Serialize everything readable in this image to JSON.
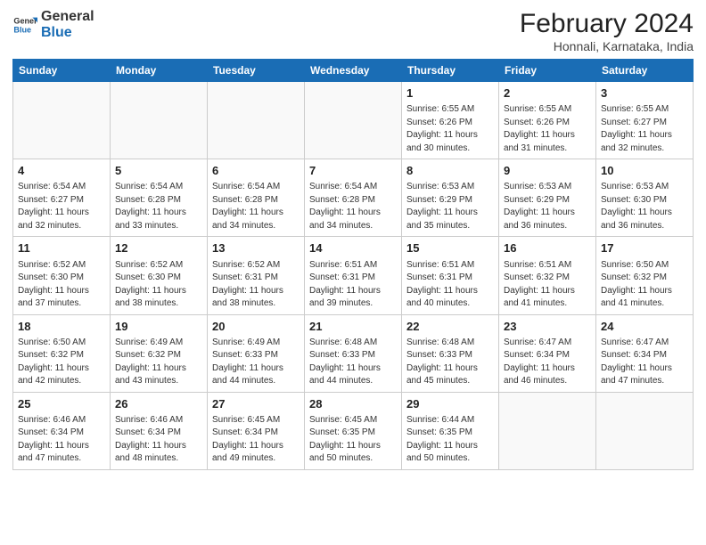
{
  "logo": {
    "line1": "General",
    "line2": "Blue"
  },
  "title": "February 2024",
  "location": "Honnali, Karnataka, India",
  "weekdays": [
    "Sunday",
    "Monday",
    "Tuesday",
    "Wednesday",
    "Thursday",
    "Friday",
    "Saturday"
  ],
  "weeks": [
    [
      {
        "day": "",
        "info": ""
      },
      {
        "day": "",
        "info": ""
      },
      {
        "day": "",
        "info": ""
      },
      {
        "day": "",
        "info": ""
      },
      {
        "day": "1",
        "info": "Sunrise: 6:55 AM\nSunset: 6:26 PM\nDaylight: 11 hours\nand 30 minutes."
      },
      {
        "day": "2",
        "info": "Sunrise: 6:55 AM\nSunset: 6:26 PM\nDaylight: 11 hours\nand 31 minutes."
      },
      {
        "day": "3",
        "info": "Sunrise: 6:55 AM\nSunset: 6:27 PM\nDaylight: 11 hours\nand 32 minutes."
      }
    ],
    [
      {
        "day": "4",
        "info": "Sunrise: 6:54 AM\nSunset: 6:27 PM\nDaylight: 11 hours\nand 32 minutes."
      },
      {
        "day": "5",
        "info": "Sunrise: 6:54 AM\nSunset: 6:28 PM\nDaylight: 11 hours\nand 33 minutes."
      },
      {
        "day": "6",
        "info": "Sunrise: 6:54 AM\nSunset: 6:28 PM\nDaylight: 11 hours\nand 34 minutes."
      },
      {
        "day": "7",
        "info": "Sunrise: 6:54 AM\nSunset: 6:28 PM\nDaylight: 11 hours\nand 34 minutes."
      },
      {
        "day": "8",
        "info": "Sunrise: 6:53 AM\nSunset: 6:29 PM\nDaylight: 11 hours\nand 35 minutes."
      },
      {
        "day": "9",
        "info": "Sunrise: 6:53 AM\nSunset: 6:29 PM\nDaylight: 11 hours\nand 36 minutes."
      },
      {
        "day": "10",
        "info": "Sunrise: 6:53 AM\nSunset: 6:30 PM\nDaylight: 11 hours\nand 36 minutes."
      }
    ],
    [
      {
        "day": "11",
        "info": "Sunrise: 6:52 AM\nSunset: 6:30 PM\nDaylight: 11 hours\nand 37 minutes."
      },
      {
        "day": "12",
        "info": "Sunrise: 6:52 AM\nSunset: 6:30 PM\nDaylight: 11 hours\nand 38 minutes."
      },
      {
        "day": "13",
        "info": "Sunrise: 6:52 AM\nSunset: 6:31 PM\nDaylight: 11 hours\nand 38 minutes."
      },
      {
        "day": "14",
        "info": "Sunrise: 6:51 AM\nSunset: 6:31 PM\nDaylight: 11 hours\nand 39 minutes."
      },
      {
        "day": "15",
        "info": "Sunrise: 6:51 AM\nSunset: 6:31 PM\nDaylight: 11 hours\nand 40 minutes."
      },
      {
        "day": "16",
        "info": "Sunrise: 6:51 AM\nSunset: 6:32 PM\nDaylight: 11 hours\nand 41 minutes."
      },
      {
        "day": "17",
        "info": "Sunrise: 6:50 AM\nSunset: 6:32 PM\nDaylight: 11 hours\nand 41 minutes."
      }
    ],
    [
      {
        "day": "18",
        "info": "Sunrise: 6:50 AM\nSunset: 6:32 PM\nDaylight: 11 hours\nand 42 minutes."
      },
      {
        "day": "19",
        "info": "Sunrise: 6:49 AM\nSunset: 6:32 PM\nDaylight: 11 hours\nand 43 minutes."
      },
      {
        "day": "20",
        "info": "Sunrise: 6:49 AM\nSunset: 6:33 PM\nDaylight: 11 hours\nand 44 minutes."
      },
      {
        "day": "21",
        "info": "Sunrise: 6:48 AM\nSunset: 6:33 PM\nDaylight: 11 hours\nand 44 minutes."
      },
      {
        "day": "22",
        "info": "Sunrise: 6:48 AM\nSunset: 6:33 PM\nDaylight: 11 hours\nand 45 minutes."
      },
      {
        "day": "23",
        "info": "Sunrise: 6:47 AM\nSunset: 6:34 PM\nDaylight: 11 hours\nand 46 minutes."
      },
      {
        "day": "24",
        "info": "Sunrise: 6:47 AM\nSunset: 6:34 PM\nDaylight: 11 hours\nand 47 minutes."
      }
    ],
    [
      {
        "day": "25",
        "info": "Sunrise: 6:46 AM\nSunset: 6:34 PM\nDaylight: 11 hours\nand 47 minutes."
      },
      {
        "day": "26",
        "info": "Sunrise: 6:46 AM\nSunset: 6:34 PM\nDaylight: 11 hours\nand 48 minutes."
      },
      {
        "day": "27",
        "info": "Sunrise: 6:45 AM\nSunset: 6:34 PM\nDaylight: 11 hours\nand 49 minutes."
      },
      {
        "day": "28",
        "info": "Sunrise: 6:45 AM\nSunset: 6:35 PM\nDaylight: 11 hours\nand 50 minutes."
      },
      {
        "day": "29",
        "info": "Sunrise: 6:44 AM\nSunset: 6:35 PM\nDaylight: 11 hours\nand 50 minutes."
      },
      {
        "day": "",
        "info": ""
      },
      {
        "day": "",
        "info": ""
      }
    ]
  ]
}
